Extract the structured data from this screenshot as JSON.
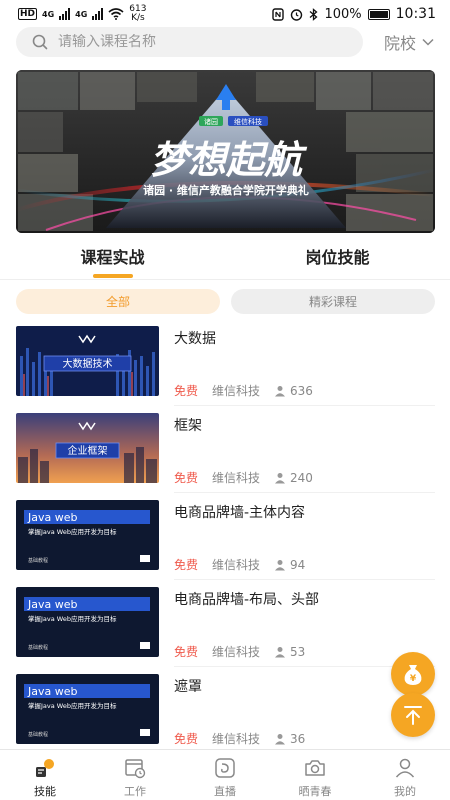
{
  "status_bar": {
    "network_badge": "HD",
    "signal1_label": "4G",
    "signal2_label": "4G",
    "speed": "613",
    "speed_unit": "K/s",
    "battery": "100%",
    "time": "10:31"
  },
  "search": {
    "placeholder": "请输入课程名称",
    "school_label": "院校"
  },
  "banner": {
    "title": "梦想起航",
    "subtitle": "诸园 · 维信产教融合学院开学典礼",
    "logo_left": "诸园",
    "logo_right": "维信科技"
  },
  "main_tabs": [
    {
      "label": "课程实战",
      "active": true
    },
    {
      "label": "岗位技能",
      "active": false
    }
  ],
  "filters": [
    {
      "label": "全部",
      "active": true
    },
    {
      "label": "精彩课程",
      "active": false
    }
  ],
  "courses": [
    {
      "title": "大数据",
      "price": "免费",
      "provider": "维信科技",
      "learners": "636",
      "thumb_caption": "大数据技术",
      "thumb_style": "bigdata"
    },
    {
      "title": "框架",
      "price": "免费",
      "provider": "维信科技",
      "learners": "240",
      "thumb_caption": "企业框架",
      "thumb_style": "framework"
    },
    {
      "title": "电商品牌墙-主体内容",
      "price": "免费",
      "provider": "维信科技",
      "learners": "94",
      "thumb_caption": "Java web",
      "thumb_sub": "掌握Java Web应用开发为目标",
      "thumb_foot": "基础教程",
      "thumb_style": "javaweb"
    },
    {
      "title": "电商品牌墙-布局、头部",
      "price": "免费",
      "provider": "维信科技",
      "learners": "53",
      "thumb_caption": "Java web",
      "thumb_sub": "掌握Java Web应用开发为目标",
      "thumb_foot": "基础教程",
      "thumb_style": "javaweb"
    },
    {
      "title": "遮罩",
      "price": "免费",
      "provider": "维信科技",
      "learners": "36",
      "thumb_caption": "Java web",
      "thumb_sub": "掌握Java Web应用开发为目标",
      "thumb_foot": "基础教程",
      "thumb_style": "javaweb"
    }
  ],
  "fabs": {
    "money_icon": "money-bag-icon",
    "top_icon": "back-to-top-icon"
  },
  "bottom_nav": [
    {
      "label": "技能",
      "icon": "skills-icon",
      "active": true
    },
    {
      "label": "工作",
      "icon": "work-calendar-icon",
      "active": false
    },
    {
      "label": "直播",
      "icon": "live-icon",
      "active": false
    },
    {
      "label": "晒青春",
      "icon": "camera-icon",
      "active": false
    },
    {
      "label": "我的",
      "icon": "profile-icon",
      "active": false
    }
  ],
  "colors": {
    "accent": "#f5a623",
    "chip_active_bg": "#fdeedb",
    "price": "#ef5a4c",
    "muted": "#888888"
  }
}
